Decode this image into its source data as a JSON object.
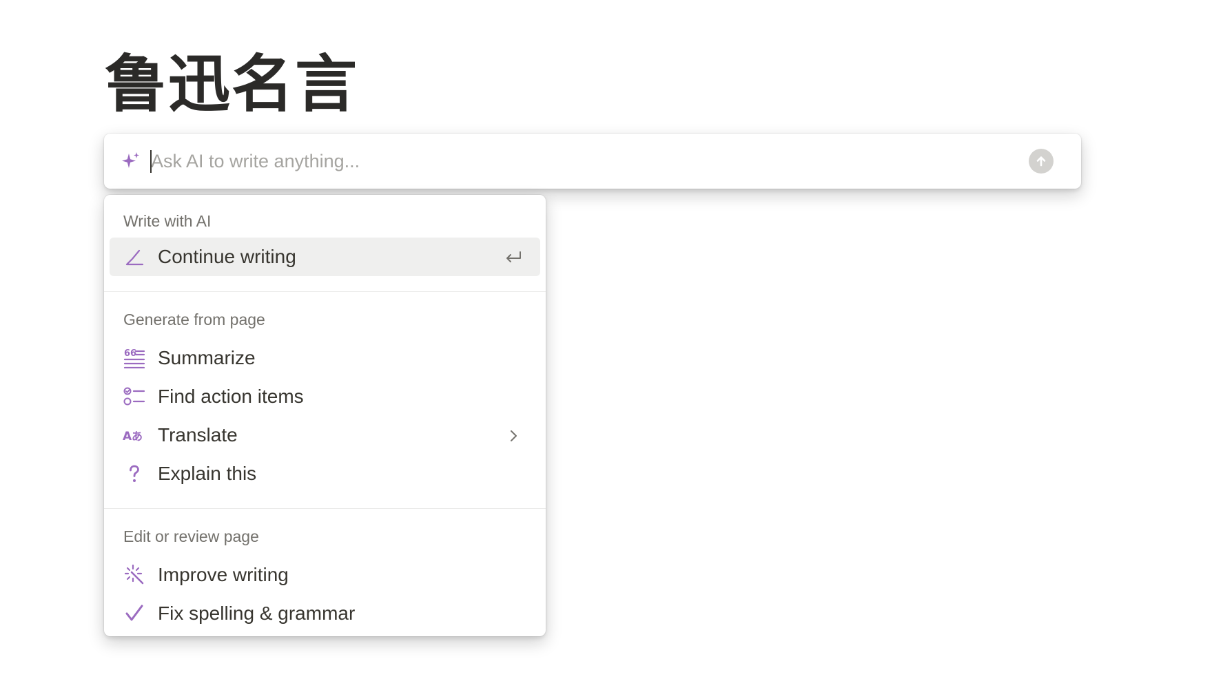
{
  "page": {
    "title": "鲁迅名言"
  },
  "ai_prompt": {
    "placeholder": "Ask AI to write anything...",
    "value": "",
    "icons": {
      "leading": "sparkle-icon",
      "submit": "arrow-up-icon"
    }
  },
  "menu": {
    "sections": [
      {
        "header": "Write with AI",
        "items": [
          {
            "label": "Continue writing",
            "icon": "pencil-icon",
            "trailing": "enter-icon",
            "selected": true
          }
        ]
      },
      {
        "header": "Generate from page",
        "items": [
          {
            "label": "Summarize",
            "icon": "summary-icon"
          },
          {
            "label": "Find action items",
            "icon": "checklist-icon"
          },
          {
            "label": "Translate",
            "icon": "translate-icon",
            "trailing": "chevron-right-icon"
          },
          {
            "label": "Explain this",
            "icon": "question-icon"
          }
        ]
      },
      {
        "header": "Edit or review page",
        "items": [
          {
            "label": "Improve writing",
            "icon": "magic-wand-icon"
          },
          {
            "label": "Fix spelling & grammar",
            "icon": "checkmark-icon"
          }
        ]
      }
    ]
  },
  "colors": {
    "accent": "#9b6bc0",
    "text": "#37352f",
    "muted": "#73716c",
    "selected_bg": "#efefee"
  }
}
